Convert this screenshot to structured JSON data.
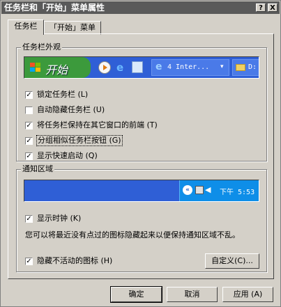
{
  "window": {
    "title": "任务栏和「开始」菜单属性",
    "help_button": "?",
    "close_button": "X"
  },
  "tabs": [
    {
      "label": "任务栏"
    },
    {
      "label": "「开始」菜单"
    }
  ],
  "appearance": {
    "group_label": "任务栏外观",
    "preview": {
      "start_label": "开始",
      "task_label": "4 Inter...",
      "folder_label": "D:"
    },
    "options": [
      {
        "label": "锁定任务栏 (L)",
        "checked": true
      },
      {
        "label": "自动隐藏任务栏 (U)",
        "checked": false
      },
      {
        "label": "将任务栏保持在其它窗口的前端 (T)",
        "checked": true
      },
      {
        "label": "分组相似任务栏按钮 (G)",
        "checked": true
      },
      {
        "label": "显示快速启动 (Q)",
        "checked": true
      }
    ]
  },
  "notification": {
    "group_label": "通知区域",
    "preview": {
      "clock_text": "下午 5:53"
    },
    "show_clock": {
      "label": "显示时钟 (K)",
      "checked": true
    },
    "description": "您可以将最近没有点过的图标隐藏起来以便保持通知区域不乱。",
    "hide_inactive": {
      "label": "隐藏不活动的图标 (H)",
      "checked": true
    },
    "customize_label": "自定义(C)..."
  },
  "buttons": {
    "ok": "确定",
    "cancel": "取消",
    "apply": "应用 (A)"
  },
  "colors": {
    "taskbar_blue": "#2f5fd6",
    "start_green": "#3c9a3c",
    "tray_blue": "#0e8ee8",
    "title_gray": "#5a5a5a"
  },
  "icons": [
    "windows-logo-icon",
    "media-player-icon",
    "ie-icon",
    "quick-launch-icon",
    "ie-task-icon",
    "dropdown-arrow-icon",
    "folder-icon",
    "chevron-left-icon",
    "network-icon",
    "speaker-icon"
  ]
}
